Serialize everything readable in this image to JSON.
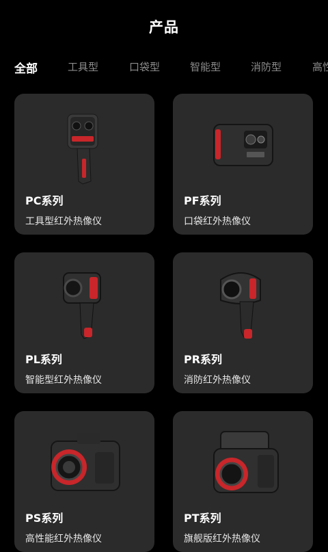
{
  "header": {
    "title": "产品"
  },
  "tabs": [
    {
      "label": "全部"
    },
    {
      "label": "工具型"
    },
    {
      "label": "口袋型"
    },
    {
      "label": "智能型"
    },
    {
      "label": "消防型"
    },
    {
      "label": "高性"
    }
  ],
  "products": [
    {
      "name": "PC系列",
      "desc": "工具型红外热像仪",
      "icon": "handheld-thermal-camera-icon"
    },
    {
      "name": "PF系列",
      "desc": "口袋红外热像仪",
      "icon": "pocket-thermal-camera-icon"
    },
    {
      "name": "PL系列",
      "desc": "智能型红外热像仪",
      "icon": "smart-thermal-camera-icon"
    },
    {
      "name": "PR系列",
      "desc": "消防红外热像仪",
      "icon": "firefighting-thermal-camera-icon"
    },
    {
      "name": "PS系列",
      "desc": "高性能红外热像仪",
      "icon": "high-performance-thermal-camera-icon"
    },
    {
      "name": "PT系列",
      "desc": "旗舰版红外热像仪",
      "icon": "flagship-thermal-camera-icon"
    }
  ],
  "colors": {
    "background": "#000000",
    "card": "#2b2b2b",
    "accent": "#c8262a",
    "tab_inactive": "#8b8b8b"
  }
}
